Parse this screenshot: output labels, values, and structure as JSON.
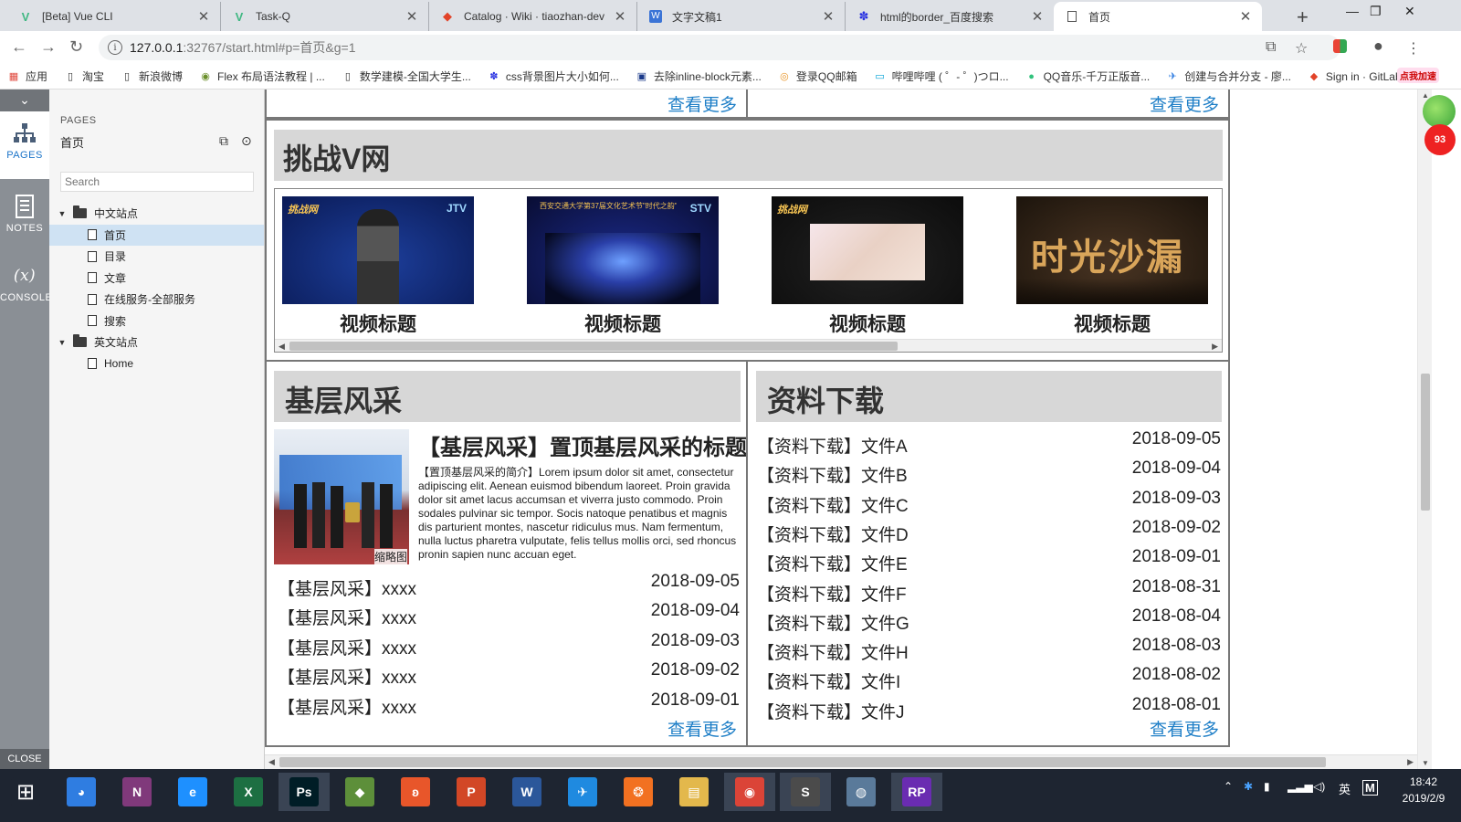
{
  "browser": {
    "tabs": [
      {
        "title": "[Beta] Vue CLI",
        "icon": "vue-icon"
      },
      {
        "title": "Task-Q",
        "icon": "vue-icon"
      },
      {
        "title": "Catalog · Wiki · tiaozhan-dev",
        "icon": "gitlab-icon"
      },
      {
        "title": "文字文稿1",
        "icon": "wps-doc-icon"
      },
      {
        "title": "html的border_百度搜索",
        "icon": "baidu-paw-icon"
      },
      {
        "title": "首页",
        "icon": "page-icon"
      }
    ],
    "url_host": "127.0.0.1",
    "url_rest": ":32767/start.html#p=首页&g=1",
    "bookmarks": [
      {
        "label": "应用",
        "icon": "apps-grid-icon"
      },
      {
        "label": "淘宝",
        "icon": "page-icon"
      },
      {
        "label": "新浪微博",
        "icon": "page-icon"
      },
      {
        "label": "Flex 布局语法教程 | ...",
        "icon": "site-icon"
      },
      {
        "label": "数学建模-全国大学生...",
        "icon": "page-icon"
      },
      {
        "label": "css背景图片大小如何...",
        "icon": "baidu-paw-icon"
      },
      {
        "label": "去除inline-block元素...",
        "icon": "site-icon"
      },
      {
        "label": "登录QQ邮箱",
        "icon": "qqmail-icon"
      },
      {
        "label": "哔哩哔哩 ( ゜- ゜)つロ...",
        "icon": "bilibili-icon"
      },
      {
        "label": "QQ音乐-千万正版音...",
        "icon": "qqmusic-icon"
      },
      {
        "label": "创建与合并分支 - 廖...",
        "icon": "site-icon"
      },
      {
        "label": "Sign in · GitLab",
        "icon": "gitlab-icon"
      }
    ],
    "badge": "点我加速"
  },
  "axure": {
    "rail": {
      "pages": "PAGES",
      "notes": "NOTES",
      "console": "CONSOLE",
      "console_glyph": "(x)",
      "close": "CLOSE"
    },
    "panel_header": "PAGES",
    "current_page": "首页",
    "search_placeholder": "Search",
    "tree": [
      {
        "label": "中文站点",
        "type": "folder",
        "level": 0
      },
      {
        "label": "首页",
        "type": "page",
        "level": 1,
        "selected": true
      },
      {
        "label": "目录",
        "type": "page",
        "level": 1
      },
      {
        "label": "文章",
        "type": "page",
        "level": 1
      },
      {
        "label": "在线服务-全部服务",
        "type": "page",
        "level": 1
      },
      {
        "label": "搜索",
        "type": "page",
        "level": 1
      },
      {
        "label": "英文站点",
        "type": "folder",
        "level": 0
      },
      {
        "label": "Home",
        "type": "page",
        "level": 1
      }
    ]
  },
  "page": {
    "more_label": "查看更多",
    "video_section": {
      "title": "挑战V网",
      "videos": [
        {
          "title": "视频标题",
          "thumb_text": "挑战网",
          "corner_logo": "JTV",
          "colors": [
            "#1d3f9c",
            "#0a1a55"
          ]
        },
        {
          "title": "视频标题",
          "thumb_text": "西安交通大学第37届文化艺术节\"时代之韵\"...",
          "corner_logo": "STV",
          "colors": [
            "#1b2a8a",
            "#090d33"
          ]
        },
        {
          "title": "视频标题",
          "thumb_text": "挑战网",
          "corner_logo": "",
          "colors": [
            "#222",
            "#0c0c0c"
          ]
        },
        {
          "title": "视频标题",
          "thumb_text": "时光沙漏",
          "corner_logo": "",
          "colors": [
            "#4a3523",
            "#1c140c"
          ]
        }
      ]
    },
    "news_section": {
      "title": "基层风采",
      "featured": {
        "title": "【基层风采】置顶基层风采的标题",
        "summary_prefix": "【置顶基层风采的简介】",
        "summary": "Lorem ipsum dolor sit amet, consectetur adipiscing elit. Aenean euismod bibendum laoreet. Proin gravida dolor sit amet lacus accumsan et viverra justo commodo. Proin sodales pulvinar sic tempor. Socis natoque penatibus et magnis dis parturient montes, nascetur ridiculus mus. Nam fermentum, nulla luctus pharetra vulputate, felis tellus mollis orci, sed rhoncus pronin sapien nunc accuan eget.",
        "thumb_caption": "缩略图"
      },
      "items": [
        {
          "title": "【基层风采】xxxx",
          "date": "2018-09-05"
        },
        {
          "title": "【基层风采】xxxx",
          "date": "2018-09-04"
        },
        {
          "title": "【基层风采】xxxx",
          "date": "2018-09-03"
        },
        {
          "title": "【基层风采】xxxx",
          "date": "2018-09-02"
        },
        {
          "title": "【基层风采】xxxx",
          "date": "2018-09-01"
        }
      ]
    },
    "download_section": {
      "title": "资料下载",
      "items": [
        {
          "title": "【资料下载】文件A",
          "date": "2018-09-05"
        },
        {
          "title": "【资料下载】文件B",
          "date": "2018-09-04"
        },
        {
          "title": "【资料下载】文件C",
          "date": "2018-09-03"
        },
        {
          "title": "【资料下载】文件D",
          "date": "2018-09-02"
        },
        {
          "title": "【资料下载】文件E",
          "date": "2018-09-01"
        },
        {
          "title": "【资料下载】文件F",
          "date": "2018-08-31"
        },
        {
          "title": "【资料下载】文件G",
          "date": "2018-08-04"
        },
        {
          "title": "【资料下载】文件H",
          "date": "2018-08-03"
        },
        {
          "title": "【资料下载】文件I",
          "date": "2018-08-02"
        },
        {
          "title": "【资料下载】文件J",
          "date": "2018-08-01"
        }
      ]
    }
  },
  "taskbar": {
    "apps": [
      {
        "name": "start-button",
        "label": "⊞",
        "color": "#1e2531",
        "running": false
      },
      {
        "name": "app-icon",
        "label": "◕",
        "color": "#2f7de1",
        "running": false
      },
      {
        "name": "onenote-icon",
        "label": "N",
        "color": "#80397b",
        "running": false
      },
      {
        "name": "ie-icon",
        "label": "e",
        "color": "#1e90ff",
        "running": false
      },
      {
        "name": "excel-icon",
        "label": "X",
        "color": "#1d6f42",
        "running": false
      },
      {
        "name": "photoshop-icon",
        "label": "Ps",
        "color": "#001d26",
        "running": true
      },
      {
        "name": "app-icon",
        "label": "◆",
        "color": "#5d8f3a",
        "running": false
      },
      {
        "name": "app-icon",
        "label": "ʚ",
        "color": "#e8562a",
        "running": false
      },
      {
        "name": "powerpoint-icon",
        "label": "P",
        "color": "#d24726",
        "running": false
      },
      {
        "name": "word-icon",
        "label": "W",
        "color": "#2b579a",
        "running": false
      },
      {
        "name": "app-icon",
        "label": "✈",
        "color": "#1f8ae0",
        "running": false
      },
      {
        "name": "app-icon",
        "label": "❂",
        "color": "#f27121",
        "running": false
      },
      {
        "name": "file-explorer-icon",
        "label": "▤",
        "color": "#e3b84c",
        "running": false
      },
      {
        "name": "chrome-icon",
        "label": "◉",
        "color": "#db4437",
        "running": true
      },
      {
        "name": "sublime-icon",
        "label": "S",
        "color": "#4b4b4b",
        "running": true
      },
      {
        "name": "app-icon",
        "label": "◍",
        "color": "#5a7a9a",
        "running": false
      },
      {
        "name": "axure-rp-icon",
        "label": "RP",
        "color": "#6a2cb1",
        "running": true
      }
    ],
    "ime": "英",
    "ime2": "M",
    "time": "18:42",
    "date": "2019/2/9"
  }
}
